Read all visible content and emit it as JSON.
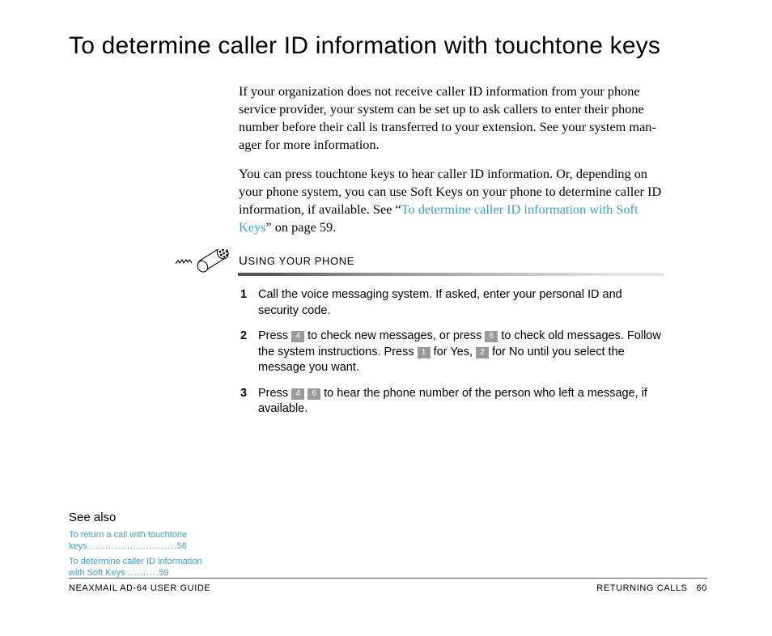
{
  "title": "To determine caller ID information with touchtone keys",
  "para1": "If your organization does not receive caller ID information from your phone service provider, your system can be set up to ask callers to enter their phone number before their call is transferred to your extension. See your system man­ager for more information.",
  "para2_pre": "You can press touchtone keys to hear caller ID informa­tion. Or, depending on your phone system, you can use Soft Keys on your phone to determine caller ID informa­tion, if available. See “",
  "para2_link": "To determine caller ID information with Soft Keys",
  "para2_post": "” on page 59.",
  "section_label": "Using your phone",
  "steps": {
    "s1": "Call the voice messaging system. If asked, enter your personal ID and security code.",
    "s2a": "Press ",
    "s2b": " to check new messages, or press ",
    "s2c": " to check old messages. Follow the system instructions. Press ",
    "s2d": " for Yes, ",
    "s2e": " for No until you select the message you want.",
    "s3a": "Press ",
    "s3b": " ",
    "s3c": " to hear the phone number of the person who left a message, if available.",
    "k4": "4",
    "k6": "6",
    "k1": "1",
    "k2": "2"
  },
  "see_also": {
    "title": "See also",
    "items": [
      {
        "text": "To return a call with touchtone keys ",
        "dots": "............................",
        "page": "56"
      },
      {
        "text": "To determine caller ID information with Soft Keys ",
        "dots": "..........",
        "page": "59"
      }
    ]
  },
  "footer": {
    "left": "NEAXMAIL AD-64 USER GUIDE",
    "right_label": "RETURNING CALLS",
    "right_page": "60"
  }
}
